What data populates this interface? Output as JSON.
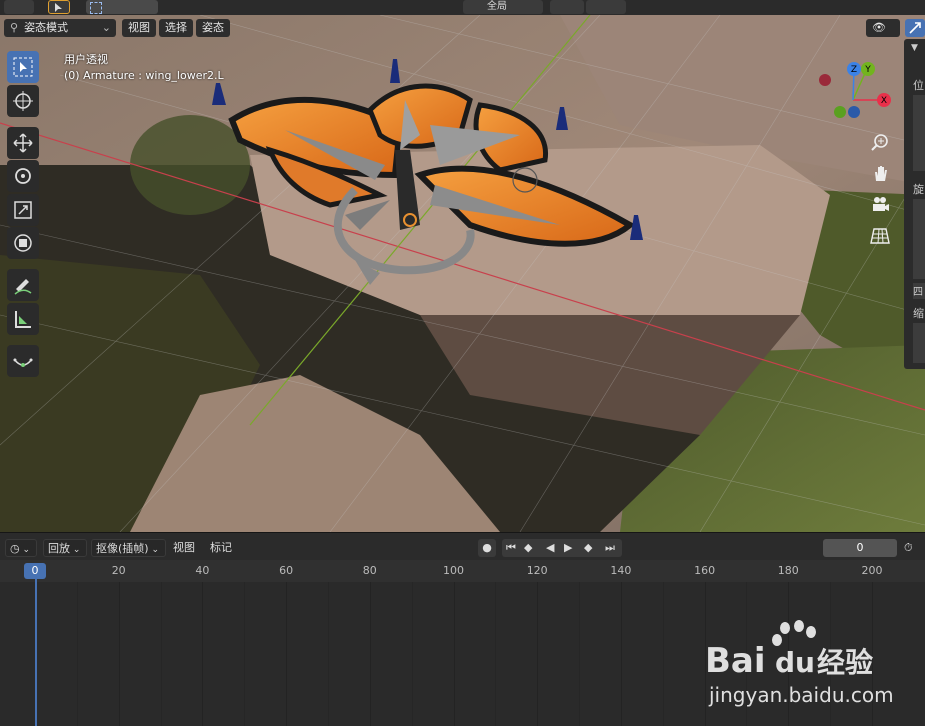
{
  "viewport_header": {
    "mode_label": "姿态模式",
    "menu_view": "视图",
    "menu_select": "选择",
    "menu_pose": "姿态"
  },
  "top_bar": {
    "orientation_label": "全局"
  },
  "overlay": {
    "view_name": "用户透视",
    "active_object": "(0) Armature : wing_lower2.L"
  },
  "gizmo": {
    "x_label": "X",
    "y_label": "Y",
    "z_label": "Z"
  },
  "side_panel": {
    "labels": [
      "位",
      "旋",
      "四",
      "缩"
    ]
  },
  "timeline": {
    "playback_label": "回放",
    "keying_label": "抠像(插帧)",
    "view_label": "视图",
    "marker_label": "标记",
    "current_frame": "0",
    "ruler_ticks": [
      "20",
      "40",
      "60",
      "80",
      "100",
      "120",
      "140",
      "160",
      "180",
      "200"
    ],
    "playhead_frame": "0"
  },
  "watermark": {
    "brand": "Bai",
    "brand2": "du",
    "product": "经验",
    "url": "jingyan.baidu.com"
  },
  "colors": {
    "accent": "#4772b3",
    "axis_x": "#e8304a",
    "axis_y": "#72b41e",
    "axis_z": "#3b82e6"
  }
}
